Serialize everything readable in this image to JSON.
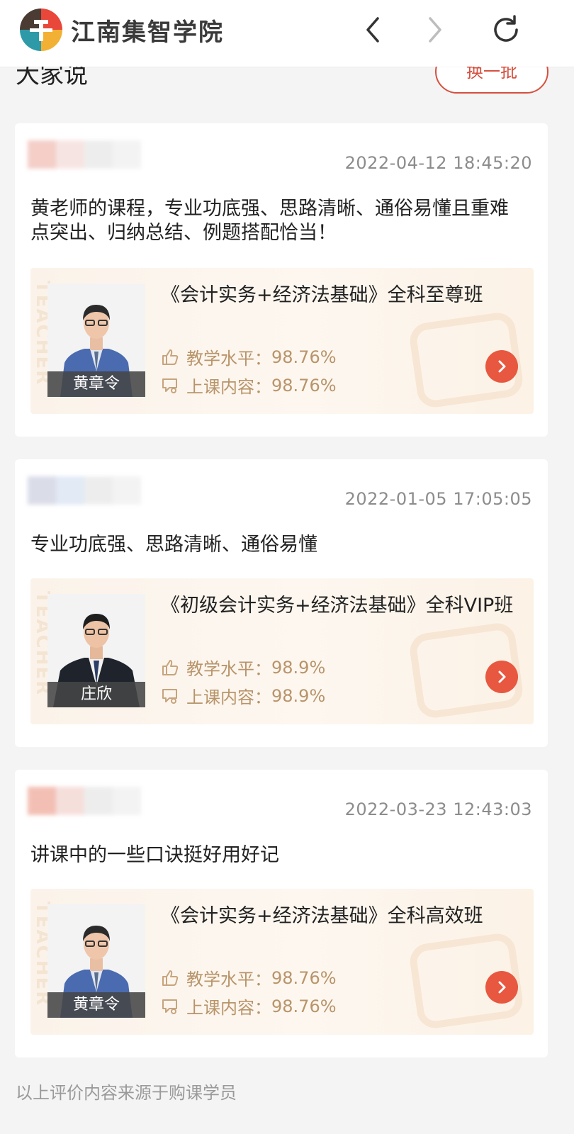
{
  "header": {
    "brand": "江南集智学院",
    "logo_icon": "jiangnan-logo-icon",
    "back_icon": "chevron-left-icon",
    "forward_icon": "chevron-right-icon",
    "refresh_icon": "refresh-icon"
  },
  "section": {
    "title": "大家说",
    "change_button": "换一批"
  },
  "reviews": [
    {
      "date": "2022-04-12 18:45:20",
      "text": "黄老师的课程，专业功底强、思路清晰、通俗易懂且重难点突出、归纳总结、例题搭配恰当！",
      "course": "《会计实务+经济法基础》全科至尊班",
      "teacher": "黄章令",
      "teaching_label": "教学水平：",
      "teaching_value": "98.76%",
      "content_label": "上课内容：",
      "content_value": "98.76%"
    },
    {
      "date": "2022-01-05 17:05:05",
      "text": "专业功底强、思路清晰、通俗易懂",
      "course": "《初级会计实务+经济法基础》全科VIP班",
      "teacher": "庄欣",
      "teaching_label": "教学水平：",
      "teaching_value": "98.9%",
      "content_label": "上课内容：",
      "content_value": "98.9%"
    },
    {
      "date": "2022-03-23 12:43:03",
      "text": "讲课中的一些口诀挺好用好记",
      "course": "《会计实务+经济法基础》全科高效班",
      "teacher": "黄章令",
      "teaching_label": "教学水平：",
      "teaching_value": "98.76%",
      "content_label": "上课内容：",
      "content_value": "98.76%"
    }
  ],
  "watermark": "TEACHER",
  "footer": "以上评价内容来源于购课学员",
  "colors": {
    "accent": "#e8573f",
    "stat_text": "#b8946a",
    "card_bg": "#ffffff",
    "page_bg": "#f4f4f4"
  }
}
